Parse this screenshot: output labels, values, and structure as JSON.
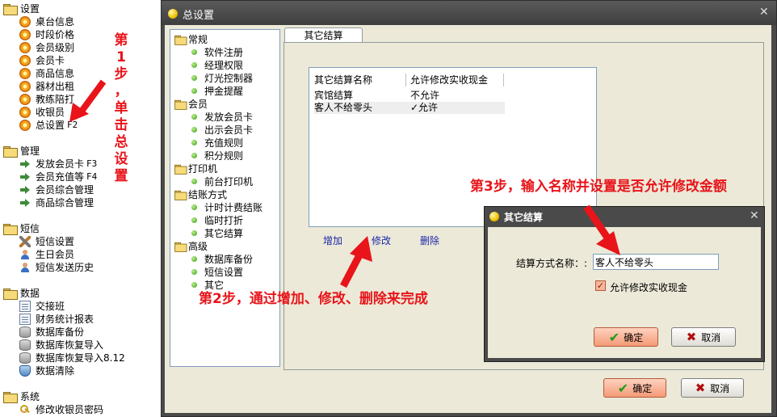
{
  "left_nav": {
    "groups": [
      {
        "label": "设置",
        "items": [
          {
            "label": "桌台信息",
            "icon": "gear-icon"
          },
          {
            "label": "时段价格",
            "icon": "gear-icon"
          },
          {
            "label": "会员级别",
            "icon": "gear-icon"
          },
          {
            "label": "会员卡",
            "icon": "gear-icon"
          },
          {
            "label": "商品信息",
            "icon": "gear-icon"
          },
          {
            "label": "器材出租",
            "icon": "gear-icon"
          },
          {
            "label": "教练陪打",
            "icon": "gear-icon"
          },
          {
            "label": "收银员",
            "icon": "gear-icon"
          },
          {
            "label": "总设置",
            "shortcut": "F2",
            "icon": "gear-icon"
          }
        ]
      },
      {
        "label": "管理",
        "items": [
          {
            "label": "发放会员卡",
            "shortcut": "F3",
            "icon": "arrow-right-icon"
          },
          {
            "label": "会员充值等",
            "shortcut": "F4",
            "icon": "arrow-right-icon"
          },
          {
            "label": "会员综合管理",
            "icon": "arrow-right-icon"
          },
          {
            "label": "商品综合管理",
            "icon": "arrow-right-icon"
          }
        ]
      },
      {
        "label": "短信",
        "items": [
          {
            "label": "短信设置",
            "icon": "tools-icon"
          },
          {
            "label": "生日会员",
            "icon": "person-icon"
          },
          {
            "label": "短信发送历史",
            "icon": "person-icon"
          }
        ]
      },
      {
        "label": "数据",
        "items": [
          {
            "label": "交接班",
            "icon": "document-icon"
          },
          {
            "label": "财务统计报表",
            "icon": "document-icon"
          },
          {
            "label": "数据库备份",
            "icon": "database-icon"
          },
          {
            "label": "数据库恢复导入",
            "icon": "database-icon"
          },
          {
            "label": "数据库恢复导入8.12",
            "icon": "database-icon"
          },
          {
            "label": "数据清除",
            "icon": "shield-icon"
          }
        ]
      },
      {
        "label": "系统",
        "items": [
          {
            "label": "修改收银员密码",
            "icon": "key-icon"
          }
        ]
      }
    ]
  },
  "annotations": {
    "step1": [
      "第",
      "1",
      "步",
      "，",
      "单",
      "击",
      "总",
      "设",
      "置"
    ],
    "step2": "第2步，通过增加、修改、删除来完成",
    "step3": "第3步，输入名称并设置是否允许修改金额",
    "color": "#e8141a"
  },
  "main_window": {
    "title": "总设置",
    "tree": [
      {
        "label": "常规",
        "items": [
          "软件注册",
          "经理权限",
          "灯光控制器",
          "押金提醒"
        ]
      },
      {
        "label": "会员",
        "items": [
          "发放会员卡",
          "出示会员卡",
          "充值规则",
          "积分规则"
        ]
      },
      {
        "label": "打印机",
        "items": [
          "前台打印机"
        ]
      },
      {
        "label": "结账方式",
        "items": [
          "计时计费结账",
          "临时打折",
          "其它结算"
        ]
      },
      {
        "label": "高级",
        "items": [
          "数据库备份",
          "短信设置",
          "其它"
        ]
      }
    ],
    "tab_label": "其它结算",
    "list": {
      "columns": [
        "其它结算名称",
        "允许修改实收现金"
      ],
      "rows": [
        {
          "name": "宾馆结算",
          "allow": "不允许"
        },
        {
          "name": "客人不给零头",
          "allow": "✓允许",
          "selected": true
        }
      ]
    },
    "actions": {
      "add": "增加",
      "edit": "修改",
      "delete": "删除"
    },
    "ok_label": "确定",
    "cancel_label": "取消"
  },
  "dialog": {
    "title": "其它结算",
    "name_label": "结算方式名称：:",
    "name_value": "客人不给零头",
    "checkbox_label": "允许修改实收现金",
    "checkbox_checked": true,
    "ok_label": "确定",
    "cancel_label": "取消"
  },
  "colors": {
    "window_frame": "#4a4a4a",
    "client_bg": "#ece9d8",
    "ok_button": "#f49a77",
    "link": "#1b26a8"
  }
}
